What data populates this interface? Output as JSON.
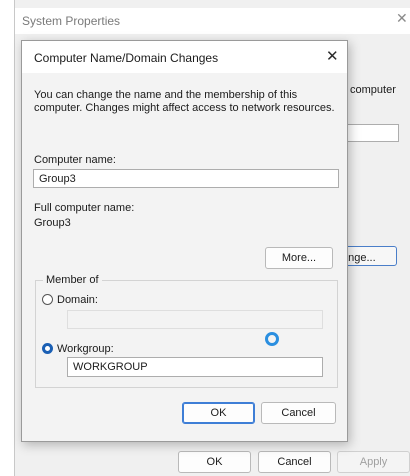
{
  "background": {
    "window_title": "System Properties",
    "close_glyph": "✕",
    "tab_text": "computer",
    "tick": "·",
    "change_label": "ange...",
    "ok_label": "OK",
    "cancel_label": "Cancel",
    "apply_label": "Apply"
  },
  "dialog": {
    "title": "Computer Name/Domain Changes",
    "close_glyph": "✕",
    "description": "You can change the name and the membership of this computer. Changes might affect access to network resources.",
    "computer_name_label": "Computer name:",
    "computer_name_value": "Group3",
    "full_name_label": "Full computer name:",
    "full_name_value": "Group3",
    "more_label": "More...",
    "member_of": {
      "legend": "Member of",
      "domain_label": "Domain:",
      "domain_value": "",
      "workgroup_label": "Workgroup:",
      "workgroup_value": "WORKGROUP",
      "selected": "workgroup"
    },
    "ok_label": "OK",
    "cancel_label": "Cancel"
  },
  "icons": {
    "close": "close-icon",
    "busy_cursor": "busy-cursor-icon"
  },
  "colors": {
    "accent": "#1a5fb4",
    "cursor": "#2b8fe0"
  }
}
